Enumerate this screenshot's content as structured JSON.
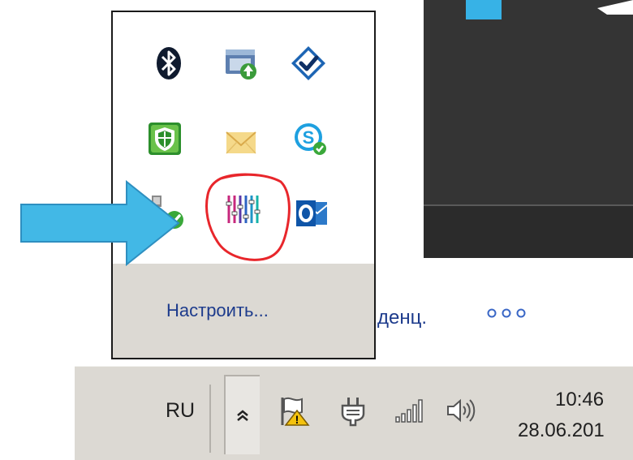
{
  "tray_popup": {
    "customize_label": "Настроить...",
    "icons": [
      {
        "name": "bluetooth-icon"
      },
      {
        "name": "network-update-icon"
      },
      {
        "name": "checkmark-shield-icon"
      },
      {
        "name": "green-shield-icon"
      },
      {
        "name": "mail-envelope-icon"
      },
      {
        "name": "skype-icon"
      },
      {
        "name": "network-connected-icon"
      },
      {
        "name": "equalizer-app-icon"
      },
      {
        "name": "outlook-icon"
      }
    ]
  },
  "background_window": {
    "partial_text": "денц."
  },
  "taskbar": {
    "language": "RU",
    "time": "10:46",
    "date": "28.06.201",
    "icons": [
      "chevron-up-icon",
      "action-center-flag-icon",
      "power-plug-icon",
      "signal-bars-icon",
      "speaker-volume-icon"
    ]
  },
  "annotations": {
    "arrow_color": "#42b8e6",
    "highlight_color": "#e8262b"
  },
  "colors": {
    "taskbar_bg": "#dcd9d3",
    "link_blue": "#1d3b8c",
    "dark_window": "#343434"
  }
}
